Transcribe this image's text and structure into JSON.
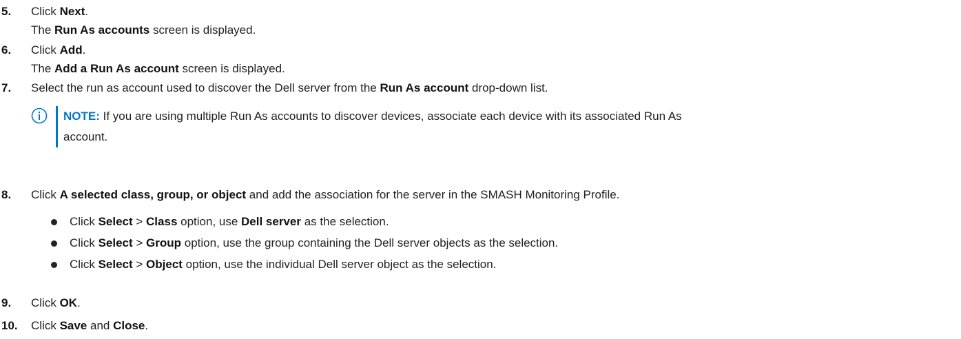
{
  "steps": [
    {
      "num": "5.",
      "line1": {
        "pre": "Click ",
        "bold": "Next",
        "post": "."
      },
      "line2": {
        "pre": "The ",
        "bold": "Run As accounts",
        "post": " screen is displayed."
      }
    },
    {
      "num": "6.",
      "line1": {
        "pre": "Click ",
        "bold": "Add",
        "post": "."
      },
      "line2": {
        "pre": "The ",
        "bold": "Add a Run As account",
        "post": " screen is displayed."
      }
    },
    {
      "num": "7.",
      "line1": {
        "pre": "Select the run as account used to discover the Dell server from the ",
        "bold": "Run As account",
        "post": " drop-down list."
      }
    },
    {
      "num": "8.",
      "line1": {
        "pre": "Click ",
        "bold": "A selected class, group, or object",
        "post": " and add the association for the server in the SMASH Monitoring Profile."
      }
    },
    {
      "num": "9.",
      "line1": {
        "pre": "Click ",
        "bold": "OK",
        "post": "."
      }
    },
    {
      "num": "10.",
      "line1": {
        "pre": "Click ",
        "bold": "Save",
        "mid": " and ",
        "bold2": "Close",
        "post": "."
      }
    }
  ],
  "note": {
    "icon": "info-circle-icon",
    "title": "NOTE:",
    "text1": " If you are using multiple Run As accounts to discover devices, associate each device with its associated Run As",
    "text2": "account.",
    "accent_color": "#0076ce"
  },
  "bullets": [
    {
      "pre": "Click ",
      "bold1": "Select",
      "sep": " > ",
      "bold2": "Class",
      "mid": " option, use ",
      "bold3": "Dell server",
      "post": " as the selection."
    },
    {
      "pre": "Click ",
      "bold1": "Select",
      "sep": " > ",
      "bold2": "Group",
      "post": " option, use the group containing the Dell server objects as the selection."
    },
    {
      "pre": "Click ",
      "bold1": "Select",
      "sep": " > ",
      "bold2": "Object",
      "post": " option, use the individual Dell server object as the selection."
    }
  ]
}
